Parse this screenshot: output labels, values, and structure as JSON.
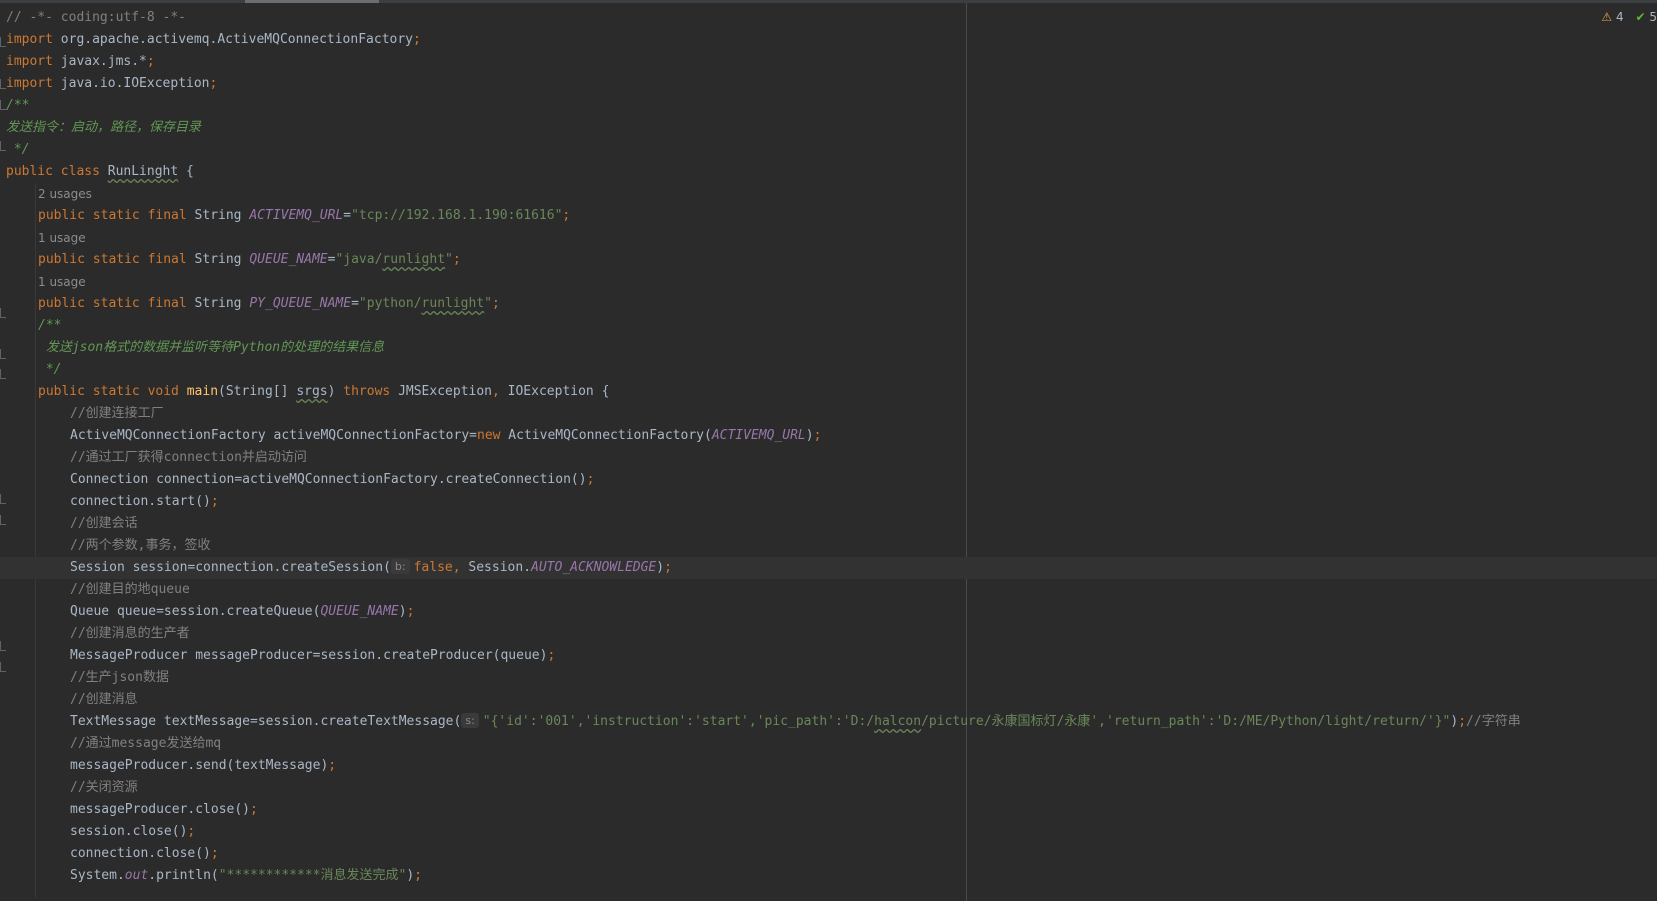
{
  "inspections": {
    "warnings_count": "4",
    "ok_count": "5",
    "warning_icon": "warning-triangle-icon",
    "ok_icon": "checkmark-icon"
  },
  "code": {
    "l01": "// -*- coding:utf-8 -*-",
    "l02_kw": "import",
    "l02_pkg": " org.apache.activemq.ActiveMQConnectionFactory",
    "l03_kw": "import",
    "l03_pkg": " javax.jms.*",
    "l04_kw": "import",
    "l04_pkg": " java.io.IOException",
    "semi": ";",
    "l05": "/**",
    "l06": "发送指令：启动，路径，保存目录",
    "l07": " */",
    "l08_kw": "public class",
    "l08_sp": " ",
    "l08_name": "RunLinght",
    "l08_rest": " {",
    "l09_hint": "2 usages",
    "field_kw": "public static final",
    "field_type": " String ",
    "l10_name": "ACTIVEMQ_URL",
    "eq": "=",
    "l10_val": "\"tcp://192.168.1.190:61616\"",
    "l11_hint": "1 usage",
    "l12_name": "QUEUE_NAME",
    "l12_q1": "\"java/",
    "l12_typo": "runlight",
    "l12_q2": "\"",
    "l13_hint": "1 usage",
    "l14_name": "PY_QUEUE_NAME",
    "l14_q1": "\"python/",
    "l14_typo": "runlight",
    "l14_q2": "\"",
    "l15": "/**",
    "l16": " 发送json格式的数据并监听等待Python的处理的结果信息",
    "l17": " */",
    "l18_kw": "public static void",
    "l18_sp": " ",
    "l18_fn": "main",
    "l18_a": "(String[] ",
    "l18_typo": "srgs",
    "l18_b": ") ",
    "l18_throws": "throws",
    "l18_c": " JMSException",
    "comma": ",",
    "l18_d": " IOException {",
    "l19": "//创建连接工厂",
    "l20_a": "ActiveMQConnectionFactory activeMQConnectionFactory=",
    "l20_kw": "new",
    "l20_b": " ActiveMQConnectionFactory(",
    "l20_const": "ACTIVEMQ_URL",
    "l20_c": ")",
    "l21": "//通过工厂获得connection并启动访问",
    "l22": "Connection connection=activeMQConnectionFactory.createConnection()",
    "l23": "connection.start()",
    "l24": "//创建会话",
    "l25": "//两个参数,事务，签收",
    "l26_a": "Session session=connection.createSession(",
    "l26_hint": "b:",
    "l26_false": "false",
    "l26_b": " Session.",
    "l26_const": "AUTO_ACKNOWLEDGE",
    "l26_c": ")",
    "l27": "//创建目的地queue",
    "l28_a": "Queue queue=session.createQueue(",
    "l28_const": "QUEUE_NAME",
    "l28_b": ")",
    "l29": "//创建消息的生产者",
    "l30": "MessageProducer messageProducer=session.createProducer(queue)",
    "l31": "//生产json数据",
    "l32": "//创建消息",
    "l33_a": "TextMessage textMessage=session.createTextMessage(",
    "l33_hint": "s:",
    "l33_s1": "\"{'id':'001','instruction':'start','pic_path':'D:/",
    "l33_typo": "halcon",
    "l33_s2": "/picture/永康国标灯/永康','return_path':'D:/ME/Python/light/return/'}\"",
    "l33_b": ")",
    "l33_cm": "//字符串",
    "l34": "//通过message发送给mq",
    "l35": "messageProducer.send(textMessage)",
    "l36": "//关闭资源",
    "l37": "messageProducer.close()",
    "l38": "session.close()",
    "l39": "connection.close()",
    "l40_a": "System.",
    "l40_out": "out",
    "l40_b": ".println(",
    "l40_str": "\"************消息发送完成\"",
    "l40_c": ")"
  }
}
